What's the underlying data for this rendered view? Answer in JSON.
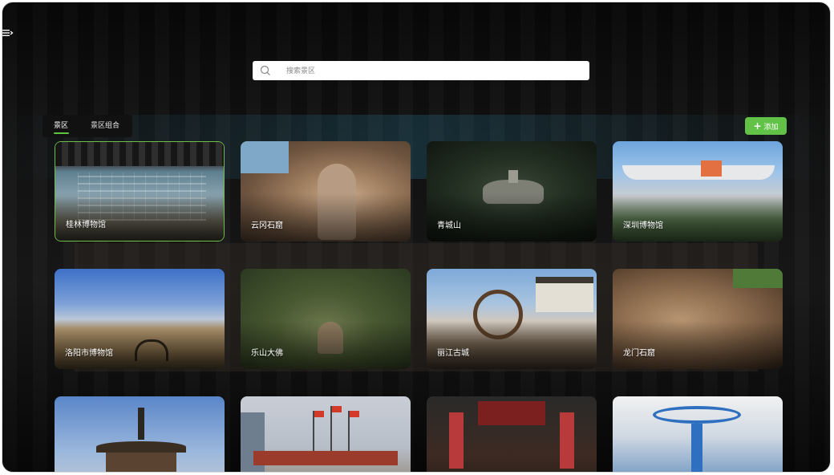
{
  "search": {
    "placeholder": "搜索景区"
  },
  "tabs": [
    {
      "label": "景区",
      "active": true
    },
    {
      "label": "景区组合",
      "active": false
    }
  ],
  "add_button": {
    "label": "添加",
    "icon": "plus-icon"
  },
  "accent_color": "#62c247",
  "scenic_spots": [
    {
      "name": "桂林博物馆",
      "selected": true
    },
    {
      "name": "云冈石窟"
    },
    {
      "name": "青城山"
    },
    {
      "name": "深圳博物馆"
    },
    {
      "name": "洛阳市博物馆"
    },
    {
      "name": "乐山大佛"
    },
    {
      "name": "丽江古城"
    },
    {
      "name": "龙门石窟"
    },
    {
      "name": ""
    },
    {
      "name": ""
    },
    {
      "name": ""
    },
    {
      "name": ""
    }
  ]
}
